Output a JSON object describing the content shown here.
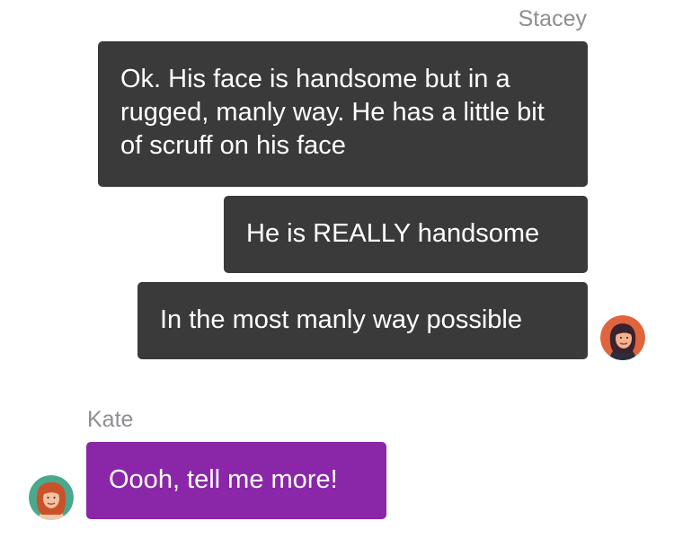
{
  "conversation": {
    "stacey": {
      "name": "Stacey",
      "avatar_icon": "stacey-avatar-icon",
      "bubble_color": "#3a3a3a",
      "messages": [
        "Ok. His face is handsome but in a rugged, manly way. He has a little bit of scruff on his face",
        "He is REALLY handsome",
        "In the most manly way possible"
      ]
    },
    "kate": {
      "name": "Kate",
      "avatar_icon": "kate-avatar-icon",
      "bubble_color": "#8a27a8",
      "messages": [
        "Oooh, tell me more!"
      ]
    }
  }
}
